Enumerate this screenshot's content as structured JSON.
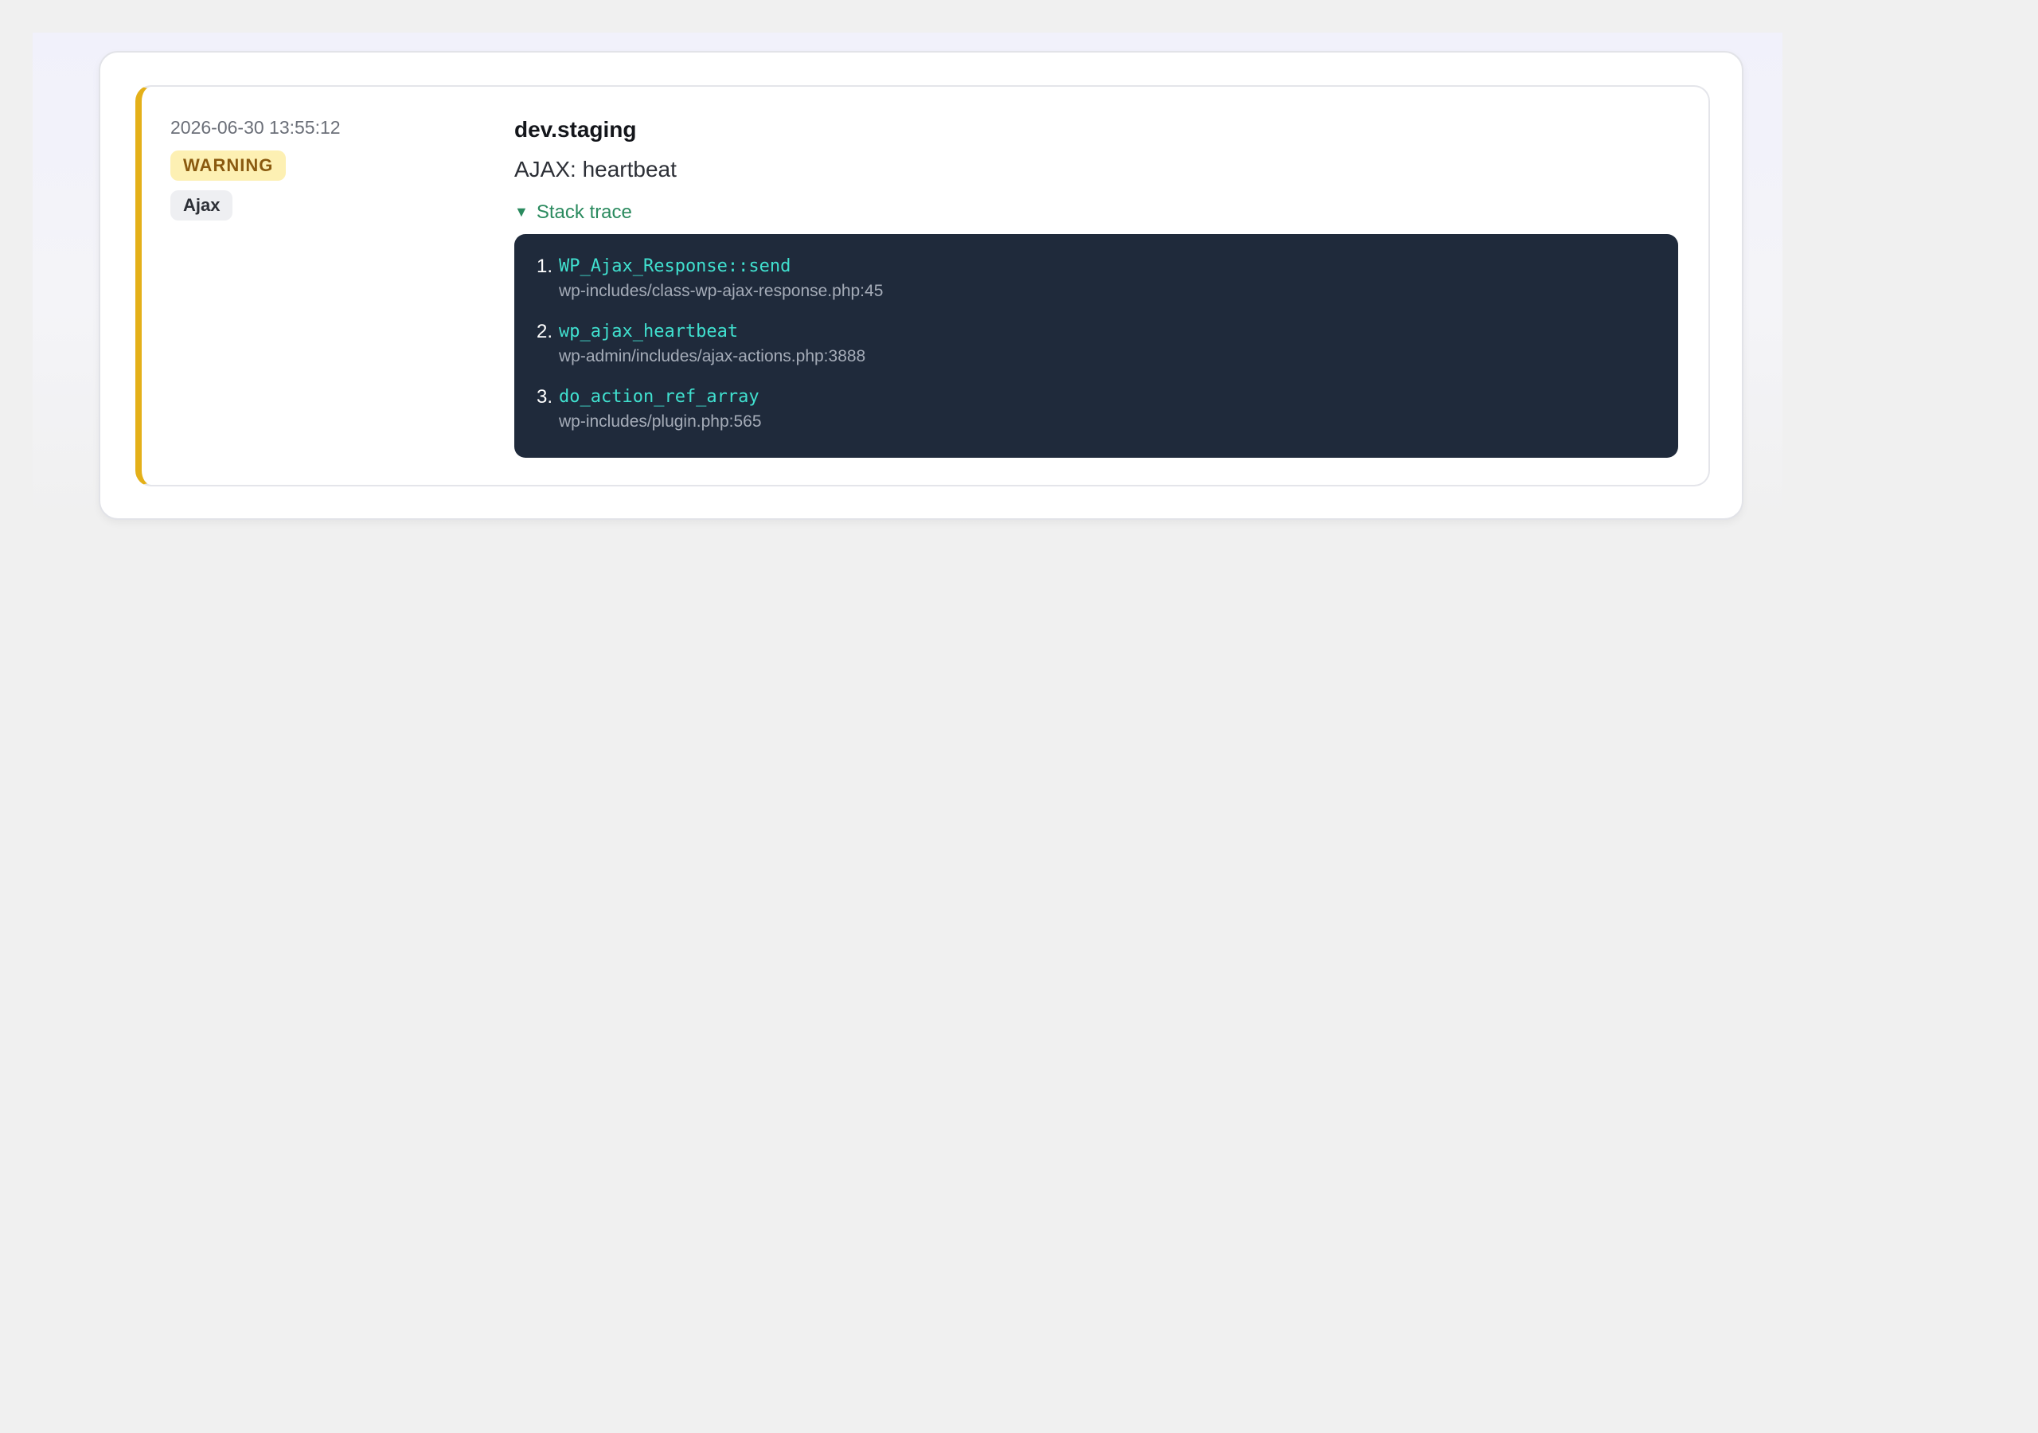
{
  "entry": {
    "timestamp": "2026-06-30 13:55:12",
    "level": "WARNING",
    "category": "Ajax",
    "site": "dev.staging",
    "message": "AJAX: heartbeat",
    "trace_toggle_label": "Stack trace",
    "trace_toggle_icon": "caret-down-icon",
    "level_color": "#e4b019",
    "trace": [
      {
        "num": "1.",
        "function": "WP_Ajax_Response::send",
        "file": "wp-includes/class-wp-ajax-response.php:45"
      },
      {
        "num": "2.",
        "function": "wp_ajax_heartbeat",
        "file": "wp-admin/includes/ajax-actions.php:3888"
      },
      {
        "num": "3.",
        "function": "do_action_ref_array",
        "file": "wp-includes/plugin.php:565"
      }
    ]
  },
  "colors": {
    "trace_bg": "#1f2a3b",
    "function_text": "#40e0cf",
    "toggle_text": "#2a8a5e",
    "warning_badge_bg": "#fdf0b3"
  }
}
